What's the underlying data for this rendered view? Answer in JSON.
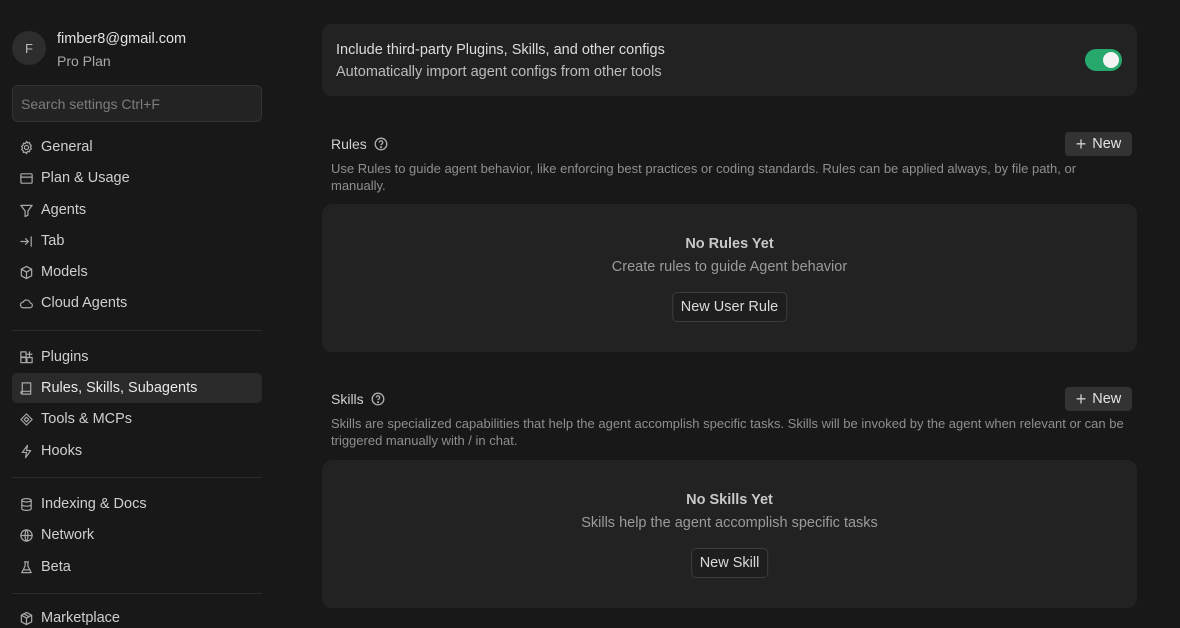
{
  "account": {
    "avatar_initial": "F",
    "email": "fimber8@gmail.com",
    "plan": "Pro Plan"
  },
  "search": {
    "placeholder": "Search settings Ctrl+F"
  },
  "sidebar": {
    "groups": [
      [
        {
          "label": "General",
          "icon": "gear-icon"
        },
        {
          "label": "Plan & Usage",
          "icon": "credit-card-icon"
        },
        {
          "label": "Agents",
          "icon": "agent-icon"
        },
        {
          "label": "Tab",
          "icon": "tab-arrow-icon"
        },
        {
          "label": "Models",
          "icon": "cube-icon"
        },
        {
          "label": "Cloud Agents",
          "icon": "cloud-icon"
        }
      ],
      [
        {
          "label": "Plugins",
          "icon": "plugin-icon"
        },
        {
          "label": "Rules, Skills, Subagents",
          "icon": "book-icon",
          "active": true
        },
        {
          "label": "Tools & MCPs",
          "icon": "tools-icon"
        },
        {
          "label": "Hooks",
          "icon": "lightning-icon"
        }
      ],
      [
        {
          "label": "Indexing & Docs",
          "icon": "database-icon"
        },
        {
          "label": "Network",
          "icon": "globe-icon"
        },
        {
          "label": "Beta",
          "icon": "flask-icon"
        }
      ],
      [
        {
          "label": "Marketplace",
          "icon": "package-icon"
        }
      ]
    ]
  },
  "third_party": {
    "title": "Include third-party Plugins, Skills, and other configs",
    "subtitle": "Automatically import agent configs from other tools",
    "enabled": true,
    "accent_color": "#27a86c"
  },
  "rules": {
    "title": "Rules",
    "description": "Use Rules to guide agent behavior, like enforcing best practices or coding standards. Rules can be applied always, by file path, or manually.",
    "new_label": "New",
    "empty_title": "No Rules Yet",
    "empty_subtitle": "Create rules to guide Agent behavior",
    "empty_button": "New User Rule"
  },
  "skills": {
    "title": "Skills",
    "description": "Skills are specialized capabilities that help the agent accomplish specific tasks. Skills will be invoked by the agent when relevant or can be triggered manually with / in chat.",
    "new_label": "New",
    "empty_title": "No Skills Yet",
    "empty_subtitle": "Skills help the agent accomplish specific tasks",
    "empty_button": "New Skill"
  }
}
